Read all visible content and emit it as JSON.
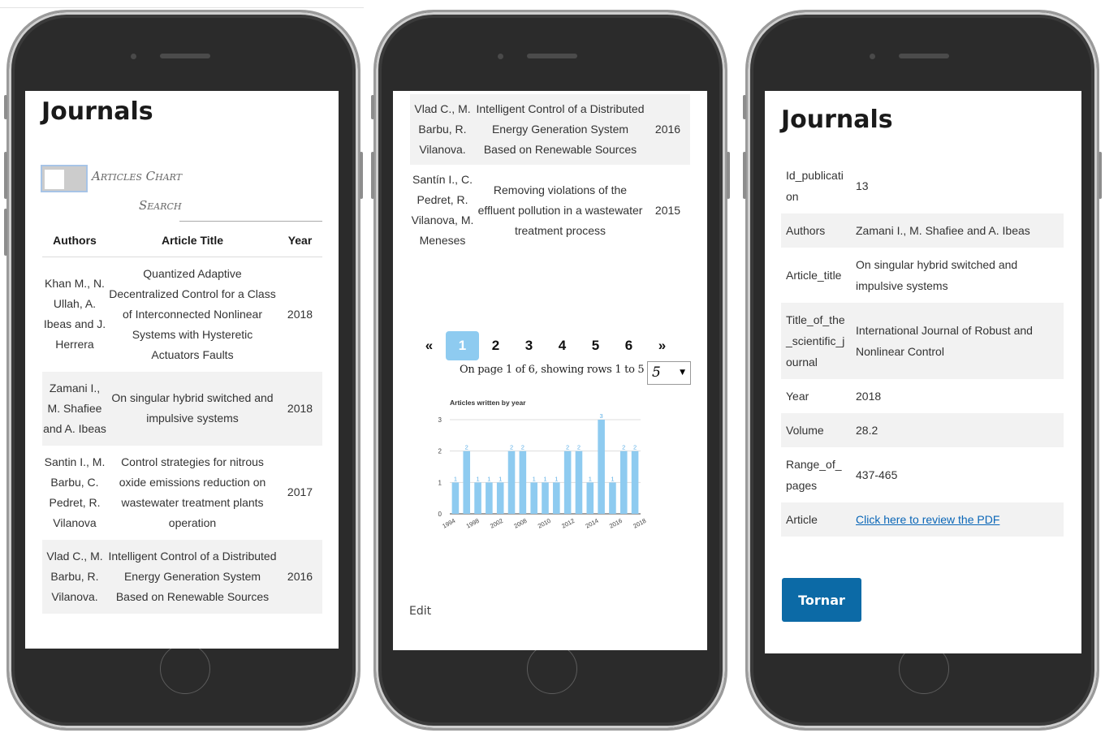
{
  "screen1": {
    "title": "Journals",
    "toggle_label": "Articles Chart",
    "search_label": "Search",
    "columns": [
      "Authors",
      "Article Title",
      "Year"
    ],
    "rows": [
      {
        "authors": "Khan M., N. Ullah, A. Ibeas and J. Herrera",
        "title": "Quantized Adaptive Decentralized Control for a Class of Interconnected Nonlinear Systems with Hysteretic Actuators Faults",
        "year": "2018"
      },
      {
        "authors": "Zamani I., M. Shafiee and A. Ibeas",
        "title": "On singular hybrid switched and impulsive systems",
        "year": "2018"
      },
      {
        "authors": "Santin I., M. Barbu, C. Pedret, R. Vilanova",
        "title": "Control strategies for nitrous oxide emissions reduction on wastewater treatment plants operation",
        "year": "2017"
      },
      {
        "authors": "Vlad C., M. Barbu, R. Vilanova.",
        "title": "Intelligent Control of a Distributed Energy Generation System Based on Renewable Sources",
        "year": "2016"
      }
    ]
  },
  "screen2": {
    "rows": [
      {
        "authors": "Vlad C., M. Barbu, R. Vilanova.",
        "title": "Intelligent Control of a Distributed Energy Generation System Based on Renewable Sources",
        "year": "2016"
      },
      {
        "authors": "Santín I., C. Pedret, R. Vilanova, M. Meneses",
        "title": "Removing violations of the effluent pollution in a wastewater treatment process",
        "year": "2015"
      }
    ],
    "pager": {
      "prev": "«",
      "pages": [
        "1",
        "2",
        "3",
        "4",
        "5",
        "6"
      ],
      "active": "1",
      "next": "»"
    },
    "page_info": "On page 1 of 6, showing rows 1 to 5 of 26",
    "rows_per_page": "5",
    "edit_label": "Edit"
  },
  "chart_data": {
    "type": "bar",
    "title": "Articles written by year",
    "x": [
      1994,
      1996,
      1998,
      2000,
      2002,
      2006,
      2008,
      2009,
      2010,
      2011,
      2012,
      2013,
      2014,
      2015,
      2016,
      2017,
      2018
    ],
    "values": [
      1,
      2,
      1,
      1,
      1,
      2,
      2,
      1,
      1,
      1,
      2,
      2,
      1,
      3,
      1,
      2,
      2
    ],
    "tick_labels": [
      "1994",
      "1998",
      "2002",
      "2008",
      "2010",
      "2012",
      "2014",
      "2016",
      "2018"
    ],
    "ylim": [
      0,
      3
    ],
    "yticks": [
      0,
      1,
      2,
      3
    ],
    "grid": true,
    "color": "#8ecbf0"
  },
  "screen3": {
    "title": "Journals",
    "fields": [
      {
        "key": "Id_publication",
        "value": "13"
      },
      {
        "key": "Authors",
        "value": "Zamani I., M. Shafiee and A. Ibeas"
      },
      {
        "key": "Article_title",
        "value": "On singular hybrid switched and impulsive systems"
      },
      {
        "key": "Title_of_the_scientific_journal",
        "value": "International Journal of Robust and Nonlinear Control"
      },
      {
        "key": "Year",
        "value": "2018"
      },
      {
        "key": "Volume",
        "value": "28.2"
      },
      {
        "key": "Range_of_pages",
        "value": "437-465"
      }
    ],
    "article_key": "Article",
    "article_link": "Click here to review the PDF",
    "back_button": "Tornar"
  }
}
